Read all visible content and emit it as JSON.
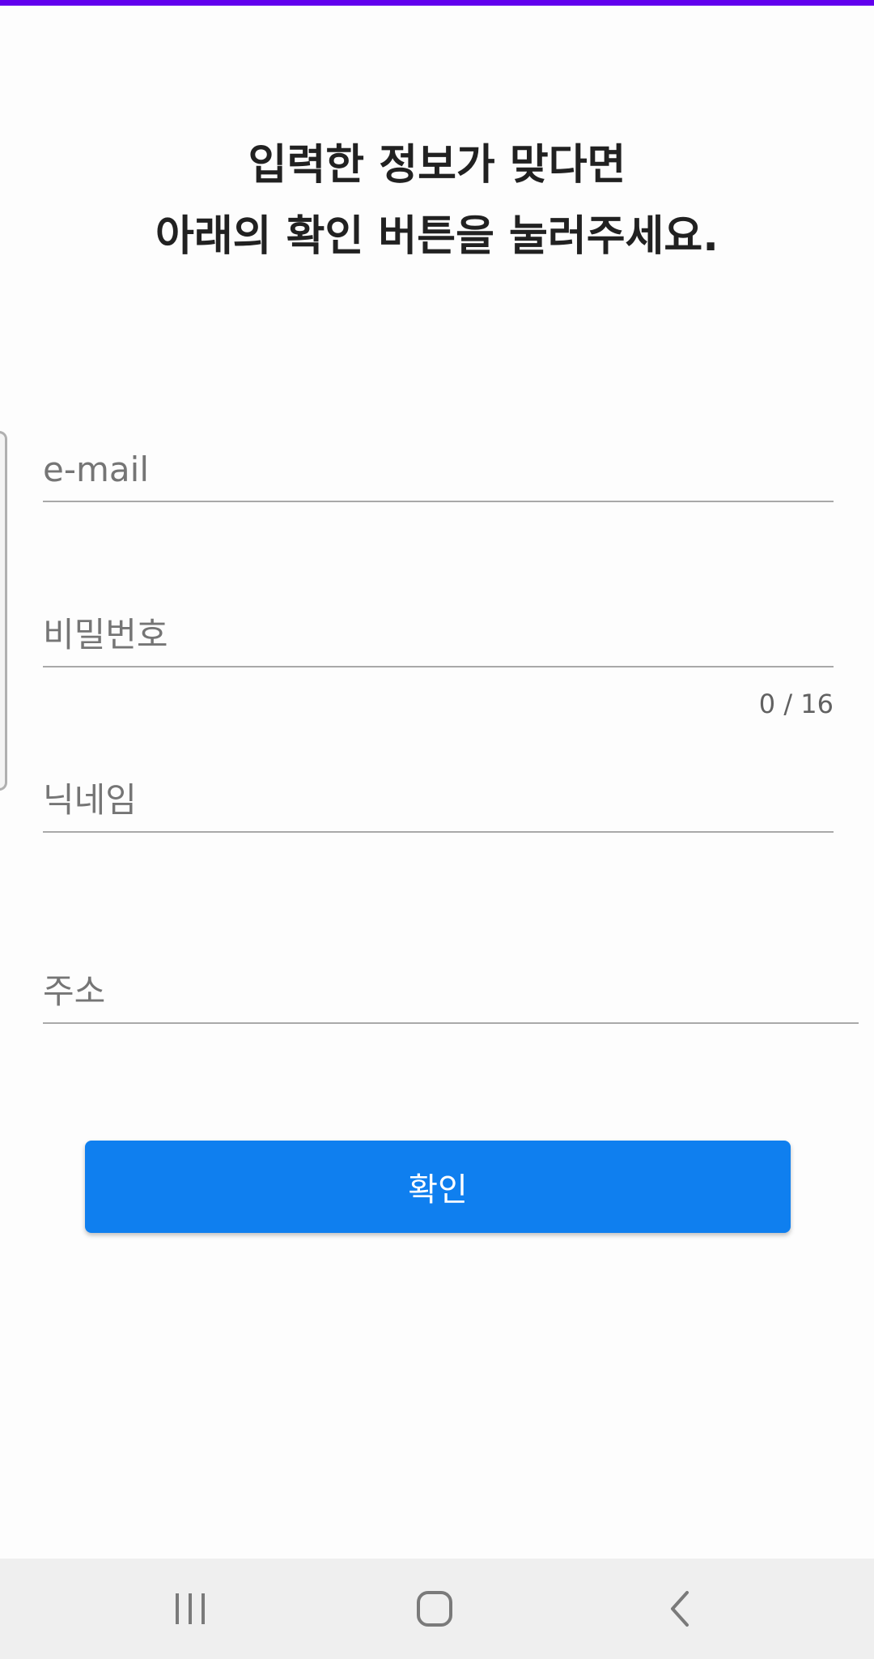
{
  "heading": {
    "line1": "입력한 정보가 맞다면",
    "line2": "아래의 확인 버튼을 눌러주세요."
  },
  "form": {
    "email": {
      "placeholder": "e-mail",
      "value": ""
    },
    "password": {
      "placeholder": "비밀번호",
      "value": "",
      "counter": "0 / 16"
    },
    "nickname": {
      "placeholder": "닉네임",
      "value": ""
    },
    "address": {
      "placeholder": "주소",
      "value": ""
    }
  },
  "confirm_button": {
    "label": "확인"
  },
  "navigation": {
    "recents_icon": "recents-icon",
    "home_icon": "home-icon",
    "back_icon": "back-icon"
  },
  "colors": {
    "accent_top": "#6200ee",
    "button": "#0f7fef",
    "nav_bar": "#efefef"
  }
}
